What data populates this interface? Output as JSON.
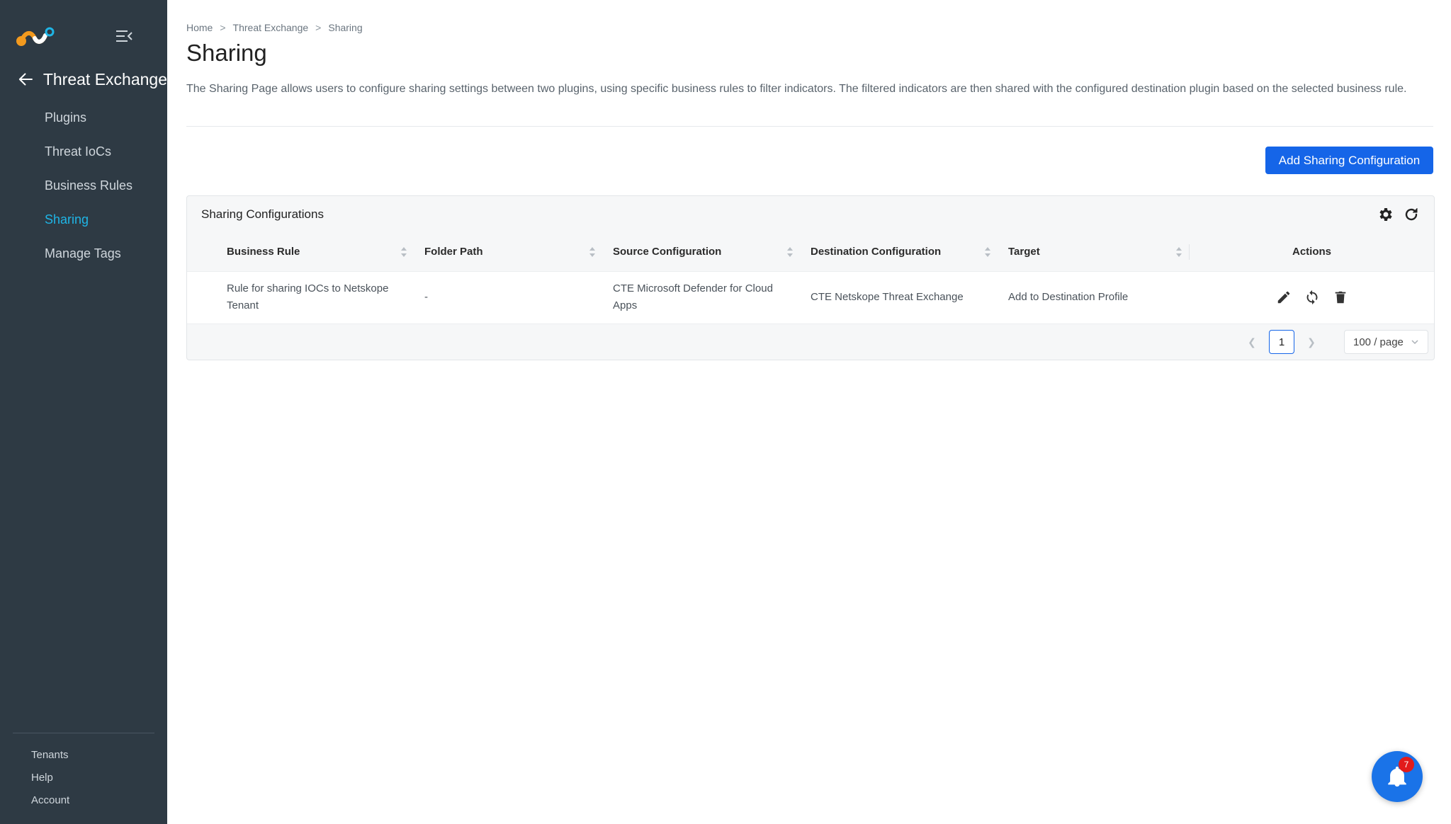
{
  "sidebar": {
    "section_title": "Threat Exchange",
    "items": [
      {
        "label": "Plugins",
        "active": false
      },
      {
        "label": "Threat IoCs",
        "active": false
      },
      {
        "label": "Business Rules",
        "active": false
      },
      {
        "label": "Sharing",
        "active": true
      },
      {
        "label": "Manage Tags",
        "active": false
      }
    ],
    "footer_items": [
      {
        "label": "Tenants"
      },
      {
        "label": "Help"
      },
      {
        "label": "Account"
      }
    ]
  },
  "breadcrumb": {
    "items": [
      "Home",
      "Threat Exchange",
      "Sharing"
    ],
    "separator": ">"
  },
  "page": {
    "title": "Sharing",
    "description": "The Sharing Page allows users to configure sharing settings between two plugins, using specific business rules to filter indicators. The filtered indicators are then shared with the configured destination plugin based on the selected business rule.",
    "add_button": "Add Sharing Configuration"
  },
  "card": {
    "title": "Sharing Configurations",
    "tools": [
      "gear-icon",
      "refresh-icon"
    ]
  },
  "table": {
    "columns": [
      "Business Rule",
      "Folder Path",
      "Source Configuration",
      "Destination Configuration",
      "Target",
      "Actions"
    ],
    "rows": [
      {
        "business_rule": "Rule for sharing IOCs to Netskope Tenant",
        "folder_path": "-",
        "source_configuration": "CTE Microsoft Defender for Cloud Apps",
        "destination_configuration": "CTE Netskope Threat Exchange",
        "target": "Add to Destination Profile",
        "actions": [
          "edit-icon",
          "sync-icon",
          "delete-icon"
        ]
      }
    ]
  },
  "pagination": {
    "current_page": "1",
    "page_size": "100 / page"
  },
  "notifications": {
    "count": "7"
  },
  "colors": {
    "sidebar_bg": "#2e3a44",
    "accent": "#1fb5e6",
    "primary": "#1565e8",
    "badge": "#e21b1b"
  }
}
